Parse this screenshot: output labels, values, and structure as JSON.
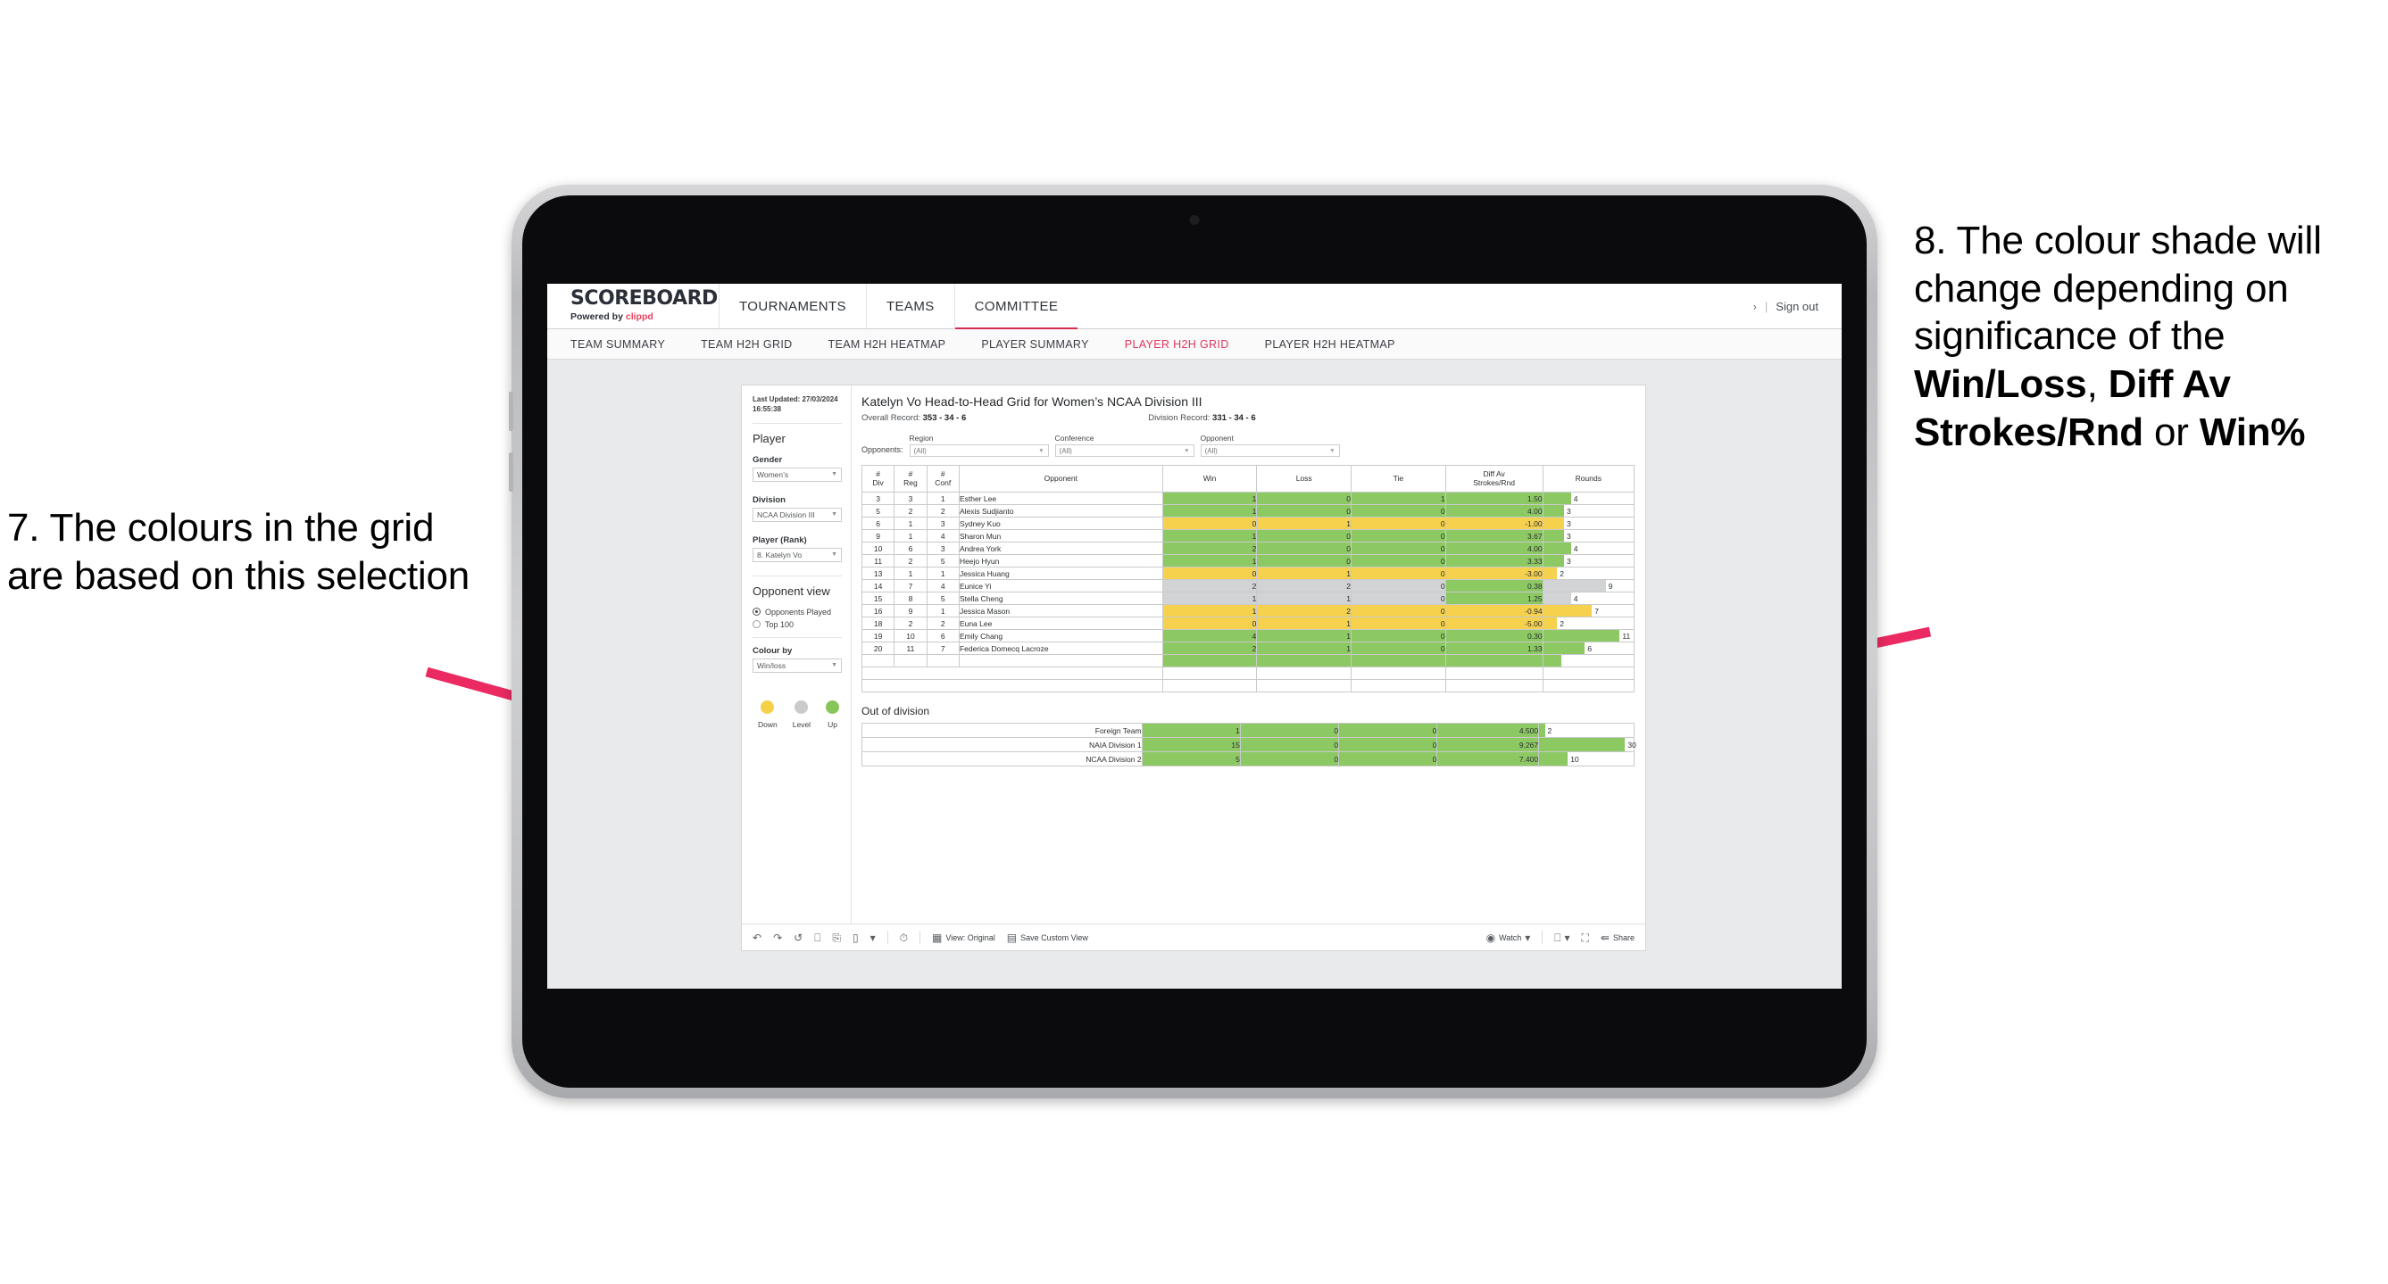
{
  "annotations": {
    "left": {
      "id": "7.",
      "text": "7. The colours in the grid are based on this selection"
    },
    "right": {
      "id": "8.",
      "parts": [
        {
          "text": "8. The colour shade will change depending on significance of the ",
          "bold": false
        },
        {
          "text": "Win/Loss",
          "bold": true
        },
        {
          "text": ", ",
          "bold": false
        },
        {
          "text": "Diff Av Strokes/Rnd",
          "bold": true
        },
        {
          "text": " or ",
          "bold": false
        },
        {
          "text": "Win%",
          "bold": true
        }
      ]
    },
    "arrow_color": "#ec2a62"
  },
  "app": {
    "brand": {
      "title": "SCOREBOARD",
      "powered_prefix": "Powered by ",
      "powered_name": "clippd"
    },
    "topnav": [
      {
        "label": "TOURNAMENTS",
        "active": false
      },
      {
        "label": "TEAMS",
        "active": false
      },
      {
        "label": "COMMITTEE",
        "active": true
      }
    ],
    "account": {
      "chevron": "›",
      "separator": "|",
      "sign_out": "Sign out"
    },
    "subnav": [
      {
        "label": "TEAM SUMMARY",
        "active": false
      },
      {
        "label": "TEAM H2H GRID",
        "active": false
      },
      {
        "label": "TEAM H2H HEATMAP",
        "active": false
      },
      {
        "label": "PLAYER SUMMARY",
        "active": false
      },
      {
        "label": "PLAYER H2H GRID",
        "active": true
      },
      {
        "label": "PLAYER H2H HEATMAP",
        "active": false
      }
    ],
    "accent_color": "#d8294f"
  },
  "sidebar": {
    "last_updated": "Last Updated: 27/03/2024 16:55:38",
    "section_player": "Player",
    "gender": {
      "label": "Gender",
      "value": "Women’s"
    },
    "division": {
      "label": "Division",
      "value": "NCAA Division III"
    },
    "player_rank": {
      "label": "Player (Rank)",
      "value": "8. Katelyn Vo"
    },
    "opponent_view": {
      "title": "Opponent view",
      "options": [
        {
          "label": "Opponents Played",
          "selected": true
        },
        {
          "label": "Top 100",
          "selected": false
        }
      ]
    },
    "colour_by": {
      "label": "Colour by",
      "value": "Win/loss"
    },
    "legend": [
      {
        "caption": "Down",
        "color": "#f5d148"
      },
      {
        "caption": "Level",
        "color": "#c9cacc"
      },
      {
        "caption": "Up",
        "color": "#87c559"
      }
    ]
  },
  "viz": {
    "title": "Katelyn Vo Head-to-Head Grid for Women’s NCAA Division III",
    "overall_record": {
      "label": "Overall Record: ",
      "value": "353 -  34 - 6"
    },
    "division_record": {
      "label": "Division Record: ",
      "value": "331 -  34 - 6"
    },
    "opponents_label": "Opponents:",
    "filters": [
      {
        "caption": "Region",
        "value": "(All)"
      },
      {
        "caption": "Conference",
        "value": "(All)"
      },
      {
        "caption": "Opponent",
        "value": "(All)"
      }
    ],
    "columns": [
      {
        "l1": "#",
        "l2": "Div"
      },
      {
        "l1": "#",
        "l2": "Reg"
      },
      {
        "l1": "#",
        "l2": "Conf"
      },
      {
        "l1": "Opponent",
        "l2": ""
      },
      {
        "l1": "Win",
        "l2": ""
      },
      {
        "l1": "Loss",
        "l2": ""
      },
      {
        "l1": "Tie",
        "l2": ""
      },
      {
        "l1": "Diff Av",
        "l2": "Strokes/Rnd"
      },
      {
        "l1": "Rounds",
        "l2": ""
      }
    ],
    "rows": [
      {
        "div": "3",
        "reg": "3",
        "conf": "1",
        "opponent": "Esther Lee",
        "win": "1",
        "loss": "0",
        "tie": "1",
        "diff": "1.50",
        "rounds": "4",
        "state": "up",
        "diff_state": "up"
      },
      {
        "div": "5",
        "reg": "2",
        "conf": "2",
        "opponent": "Alexis Sudjianto",
        "win": "1",
        "loss": "0",
        "tie": "0",
        "diff": "4.00",
        "rounds": "3",
        "state": "up",
        "diff_state": "up"
      },
      {
        "div": "6",
        "reg": "1",
        "conf": "3",
        "opponent": "Sydney Kuo",
        "win": "0",
        "loss": "1",
        "tie": "0",
        "diff": "-1.00",
        "rounds": "3",
        "state": "down",
        "diff_state": "down"
      },
      {
        "div": "9",
        "reg": "1",
        "conf": "4",
        "opponent": "Sharon Mun",
        "win": "1",
        "loss": "0",
        "tie": "0",
        "diff": "3.67",
        "rounds": "3",
        "state": "up",
        "diff_state": "up"
      },
      {
        "div": "10",
        "reg": "6",
        "conf": "3",
        "opponent": "Andrea York",
        "win": "2",
        "loss": "0",
        "tie": "0",
        "diff": "4.00",
        "rounds": "4",
        "state": "up",
        "diff_state": "up"
      },
      {
        "div": "11",
        "reg": "2",
        "conf": "5",
        "opponent": "Heejo Hyun",
        "win": "1",
        "loss": "0",
        "tie": "0",
        "diff": "3.33",
        "rounds": "3",
        "state": "up",
        "diff_state": "up"
      },
      {
        "div": "13",
        "reg": "1",
        "conf": "1",
        "opponent": "Jessica Huang",
        "win": "0",
        "loss": "1",
        "tie": "0",
        "diff": "-3.00",
        "rounds": "2",
        "state": "down",
        "diff_state": "down"
      },
      {
        "div": "14",
        "reg": "7",
        "conf": "4",
        "opponent": "Eunice Yi",
        "win": "2",
        "loss": "2",
        "tie": "0",
        "diff": "0.38",
        "rounds": "9",
        "state": "level",
        "diff_state": "up"
      },
      {
        "div": "15",
        "reg": "8",
        "conf": "5",
        "opponent": "Stella Cheng",
        "win": "1",
        "loss": "1",
        "tie": "0",
        "diff": "1.25",
        "rounds": "4",
        "state": "level",
        "diff_state": "up"
      },
      {
        "div": "16",
        "reg": "9",
        "conf": "1",
        "opponent": "Jessica Mason",
        "win": "1",
        "loss": "2",
        "tie": "0",
        "diff": "-0.94",
        "rounds": "7",
        "state": "down",
        "diff_state": "down"
      },
      {
        "div": "18",
        "reg": "2",
        "conf": "2",
        "opponent": "Euna Lee",
        "win": "0",
        "loss": "1",
        "tie": "0",
        "diff": "-5.00",
        "rounds": "2",
        "state": "down",
        "diff_state": "down"
      },
      {
        "div": "19",
        "reg": "10",
        "conf": "6",
        "opponent": "Emily Chang",
        "win": "4",
        "loss": "1",
        "tie": "0",
        "diff": "0.30",
        "rounds": "11",
        "state": "up",
        "diff_state": "up"
      },
      {
        "div": "20",
        "reg": "11",
        "conf": "7",
        "opponent": "Federica Domecq Lacroze",
        "win": "2",
        "loss": "1",
        "tie": "0",
        "diff": "1.33",
        "rounds": "6",
        "state": "up",
        "diff_state": "up"
      }
    ],
    "rounds_max": 13,
    "out_of_division": {
      "title": "Out of division",
      "rows": [
        {
          "name": "Foreign Team",
          "win": "1",
          "loss": "0",
          "tie": "0",
          "diff": "4.500",
          "rounds": "2",
          "state": "up"
        },
        {
          "name": "NAIA Division 1",
          "win": "15",
          "loss": "0",
          "tie": "0",
          "diff": "9.267",
          "rounds": "30",
          "state": "up"
        },
        {
          "name": "NCAA Division 2",
          "win": "5",
          "loss": "0",
          "tie": "0",
          "diff": "7.400",
          "rounds": "10",
          "state": "up"
        }
      ],
      "rounds_max": 33
    },
    "colors": {
      "up": "#8cc963",
      "down": "#f5d14e",
      "level": "#d2d3d5"
    }
  },
  "toolbar": {
    "icons": [
      "undo-icon",
      "redo-icon",
      "revert-icon",
      "refresh-icon",
      "pause-icon",
      "layout-icon",
      "caret-down-icon",
      "alert-icon"
    ],
    "view_original": "View: Original",
    "save_custom_view": "Save Custom View",
    "watch": "Watch",
    "share": "Share"
  }
}
